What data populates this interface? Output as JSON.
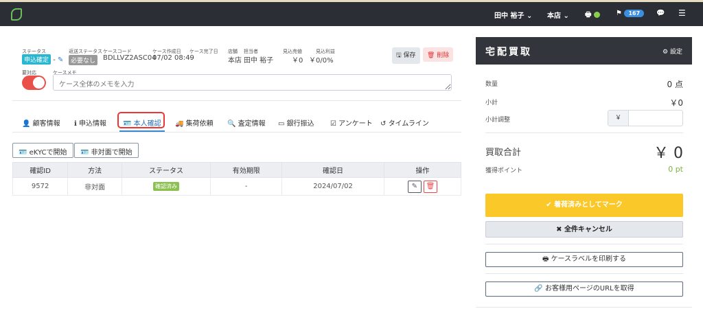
{
  "topbar": {
    "user": "田中 裕子",
    "store": "本店",
    "notifications": "167"
  },
  "case": {
    "status_label": "ステータス",
    "status": "申込確定",
    "status_dash": "-",
    "return_label": "返送ステータス",
    "return_status": "必要なし",
    "code_label": "ケースコード",
    "code": "BDLLVZ2ASC04",
    "created_label": "ケース作成日",
    "created": "07/02 08:49",
    "done_label": "ケース完了日",
    "done": "-",
    "store_label": "店舗",
    "store": "本店",
    "staff_label": "担当者",
    "staff": "田中 裕子",
    "sales_label": "見込売値",
    "sales": "￥0",
    "profit_label": "見込利益",
    "profit": "￥0/0%",
    "save": "保存",
    "delete": "削除",
    "attention_label": "要対応",
    "memo_label": "ケースメモ",
    "memo_placeholder": "ケース全体のメモを入力"
  },
  "tabs": [
    "顧客情報",
    "申込情報",
    "本人確認",
    "集荷依頼",
    "査定情報",
    "銀行振込",
    "アンケート",
    "タイムライン"
  ],
  "actions": {
    "ekyc": "eKYCで開始",
    "offline": "非対面で開始"
  },
  "table": {
    "headers": [
      "確認ID",
      "方法",
      "ステータス",
      "有効期限",
      "確認日",
      "操作"
    ],
    "rows": [
      {
        "id": "9572",
        "method": "非対面",
        "status": "確認済み",
        "expiry": "-",
        "date": "2024/07/02"
      }
    ]
  },
  "panel": {
    "title": "宅配買取",
    "settings": "設定",
    "qty_label": "数量",
    "qty": "0 点",
    "subtotal_label": "小計",
    "subtotal": "￥0",
    "adjust_label": "小計調整",
    "yen": "￥",
    "total_label": "買取合計",
    "total": "￥ 0",
    "points_label": "獲得ポイント",
    "points": "0 pt",
    "mark_arrived": "着荷済みとしてマーク",
    "cancel_all": "全件キャンセル",
    "print_label": "ケースラベルを印刷する",
    "get_url": "お客様用ページのURLを取得"
  }
}
